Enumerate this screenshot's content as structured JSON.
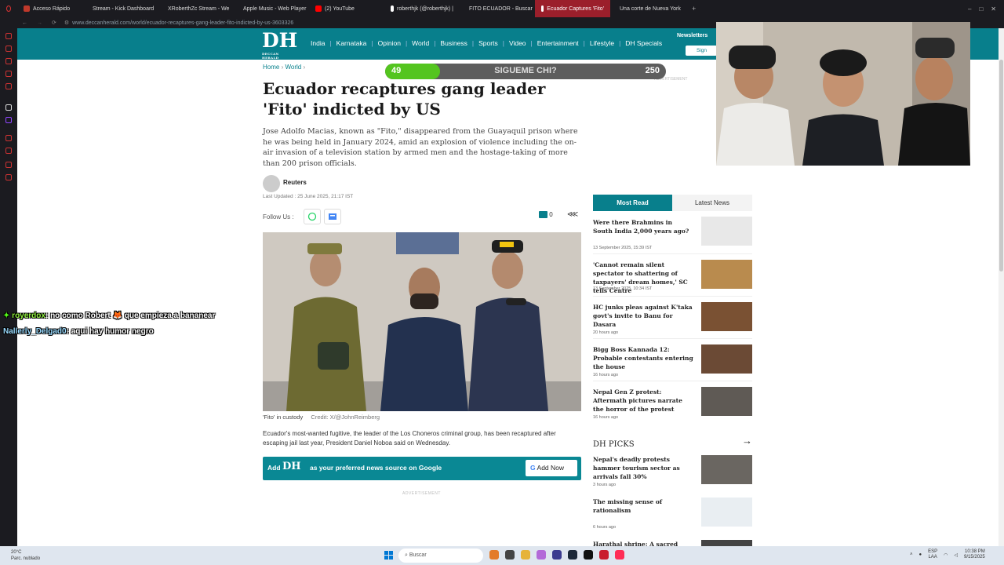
{
  "browser": {
    "tabs": [
      {
        "label": "Acceso Rápido",
        "color": "#c0392b"
      },
      {
        "label": "Stream - Kick Dashboard",
        "color": "#53fc18"
      },
      {
        "label": "XRoberthZc Stream - We",
        "color": "#53fc18"
      },
      {
        "label": "Apple Music - Web Player",
        "color": "#fa2d48"
      },
      {
        "label": "(2) YouTube",
        "color": "#ff0000"
      },
      {
        "label": "roberthjk (@roberthjk) |",
        "color": "#ffffff"
      },
      {
        "label": "FITO ECUADOR - Buscar",
        "color": "#ffffff"
      },
      {
        "label": "Ecuador Captures 'Fito'",
        "color": "#ffffff",
        "active": true
      },
      {
        "label": "Una corte de Nueva York",
        "color": "#ffffff"
      }
    ],
    "url": "www.deccanherald.com/world/ecuador-recaptures-gang-leader-fito-indicted-by-us-3603326"
  },
  "site": {
    "logo": "DH",
    "logo_sub": "DECCAN HERALD",
    "nav": [
      "India",
      "Karnataka",
      "Opinion",
      "World",
      "Business",
      "Sports",
      "Video",
      "Entertainment",
      "Lifestyle",
      "DH Specials"
    ],
    "newsletters": "Newsletters",
    "signin": "Sign",
    "accent": "#087f8c"
  },
  "article": {
    "breadcrumb": [
      "Home",
      "World"
    ],
    "headline": "Ecuador recaptures gang leader 'Fito' indicted by US",
    "summary": "Jose Adolfo Macias, known as \"Fito,\" disappeared from the Guayaquil prison where he was being held in January 2024, amid an explosion of violence including the on-air invasion of a television station by armed men and the hostage-taking of more than 200 prison officials.",
    "author": "Reuters",
    "updated": "Last Updated : 25 June 2025, 21:17 IST",
    "follow_us": "Follow Us :",
    "comment_count": "0",
    "caption": "'Fito' in custody",
    "credit": "Credit: X/@JohnReimberg",
    "body": "Ecuador's most-wanted fugitive, the leader of the Los Choneros criminal group, has been recaptured after escaping jail last year, President Daniel Noboa said on Wednesday.",
    "add_banner": {
      "add": "Add",
      "logo": "DH",
      "text": "as your preferred news source on Google",
      "button": "Add Now"
    },
    "advertisement": "ADVERTISEMENT"
  },
  "sidebar": {
    "advertisement": "ADVERTISEMENT",
    "tabs": [
      "Most Read",
      "Latest News"
    ],
    "most_read": [
      {
        "title": "Were there Brahmins in South India 2,000 years ago?",
        "time": "13 September 2025, 15:39 IST",
        "thumb": "#e8e8e8"
      },
      {
        "title": "'Cannot remain silent spectator to shattering of taxpayers' dream homes,' SC tells Centre",
        "time": "13 September 2025, 10:34 IST",
        "thumb": "#b98b4e"
      },
      {
        "title": "HC junks pleas against K'taka govt's invite to Banu for Dasara",
        "time": "20 hours ago",
        "thumb": "#7a5133"
      },
      {
        "title": "Bigg Boss Kannada 12: Probable contestants entering the house",
        "time": "16 hours ago",
        "thumb": "#6b4a35"
      },
      {
        "title": "Nepal Gen Z protest: Aftermath pictures narrate the horror of the protest",
        "time": "16 hours ago",
        "thumb": "#5f5a55"
      }
    ],
    "picks_title": "DH PICKS",
    "picks": [
      {
        "title": "Nepal's deadly protests hammer tourism sector as arrivals fall 30%",
        "time": "3 hours ago",
        "thumb": "#6a6661"
      },
      {
        "title": "The missing sense of rationalism",
        "time": "6 hours ago",
        "thumb": "#e9eef2"
      },
      {
        "title": "Harathal shrine: A sacred space",
        "time": "",
        "thumb": "#444"
      }
    ]
  },
  "overlay": {
    "progress": {
      "left": "49",
      "label": "SIGUEME CHI?",
      "right": "250",
      "fraction": 0.196,
      "color": "#54c51f"
    },
    "chat": [
      {
        "user": "royerdox",
        "message": ": no como Robert 🦊 que empieza a bananear",
        "user_color": "#8ef03c"
      },
      {
        "user": "Nallerly_Delgad0",
        "message": ": aqui hay humor negro",
        "user_color": "#9adbff"
      }
    ]
  },
  "taskbar": {
    "weather_temp": "20°C",
    "weather_desc": "Parc. nublado",
    "search": "Buscar",
    "lang": "ESP",
    "lang2": "LAA",
    "time": "10:38 PM",
    "date": "9/15/2025"
  }
}
